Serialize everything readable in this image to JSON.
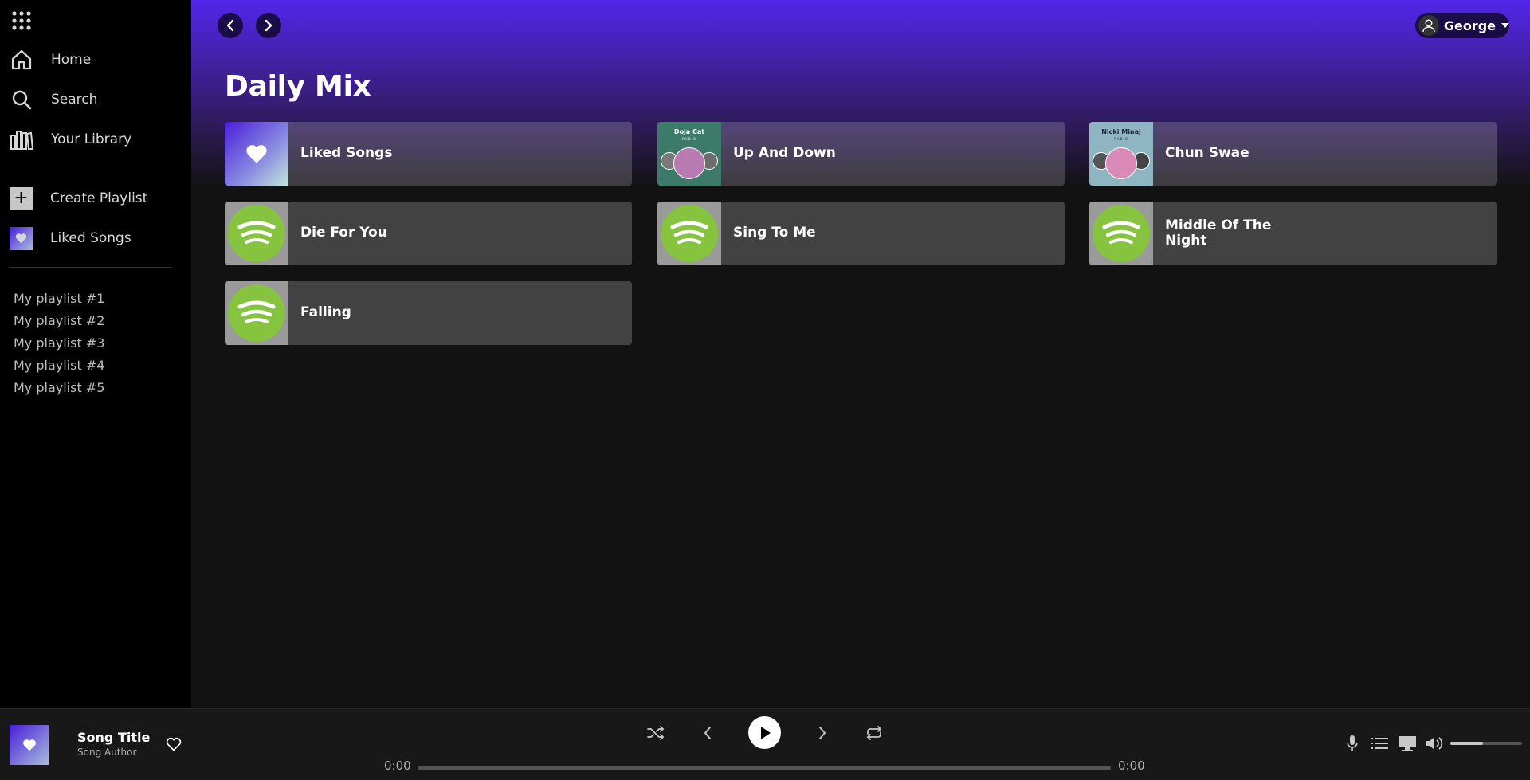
{
  "sidebar": {
    "nav": [
      {
        "label": "Home",
        "icon": "home-icon"
      },
      {
        "label": "Search",
        "icon": "search-icon"
      },
      {
        "label": "Your Library",
        "icon": "library-icon"
      }
    ],
    "create_playlist": "Create Playlist",
    "liked_songs": "Liked Songs",
    "playlists": [
      "My playlist #1",
      "My playlist #2",
      "My playlist #3",
      "My playlist #4",
      "My playlist #5"
    ]
  },
  "header": {
    "user_name": "George"
  },
  "main": {
    "title": "Daily Mix",
    "cards": [
      {
        "title": "Liked Songs",
        "cover": "liked-songs-cover"
      },
      {
        "title": "Up And Down",
        "cover": "doja-cat-radio-cover",
        "cover_text": "Doja Cat",
        "cover_sub": "RADIO"
      },
      {
        "title": "Chun Swae",
        "cover": "nicki-minaj-radio-cover",
        "cover_text": "Nicki Minaj",
        "cover_sub": "RADIO"
      },
      {
        "title": "Die For You",
        "cover": "spotify-logo-cover"
      },
      {
        "title": "Sing To Me",
        "cover": "spotify-logo-cover"
      },
      {
        "title": "Middle Of The Night",
        "cover": "spotify-logo-cover"
      },
      {
        "title": "Falling",
        "cover": "spotify-logo-cover"
      }
    ]
  },
  "player": {
    "song_title": "Song Title",
    "song_author": "Song Author",
    "time_elapsed": "0:00",
    "time_total": "0:00",
    "progress": 0,
    "volume": 0.45
  },
  "colors": {
    "accent_purple": "#5226ea",
    "spotify_green": "#86c440",
    "sidebar_bg": "#000000",
    "main_bg": "#121212"
  }
}
